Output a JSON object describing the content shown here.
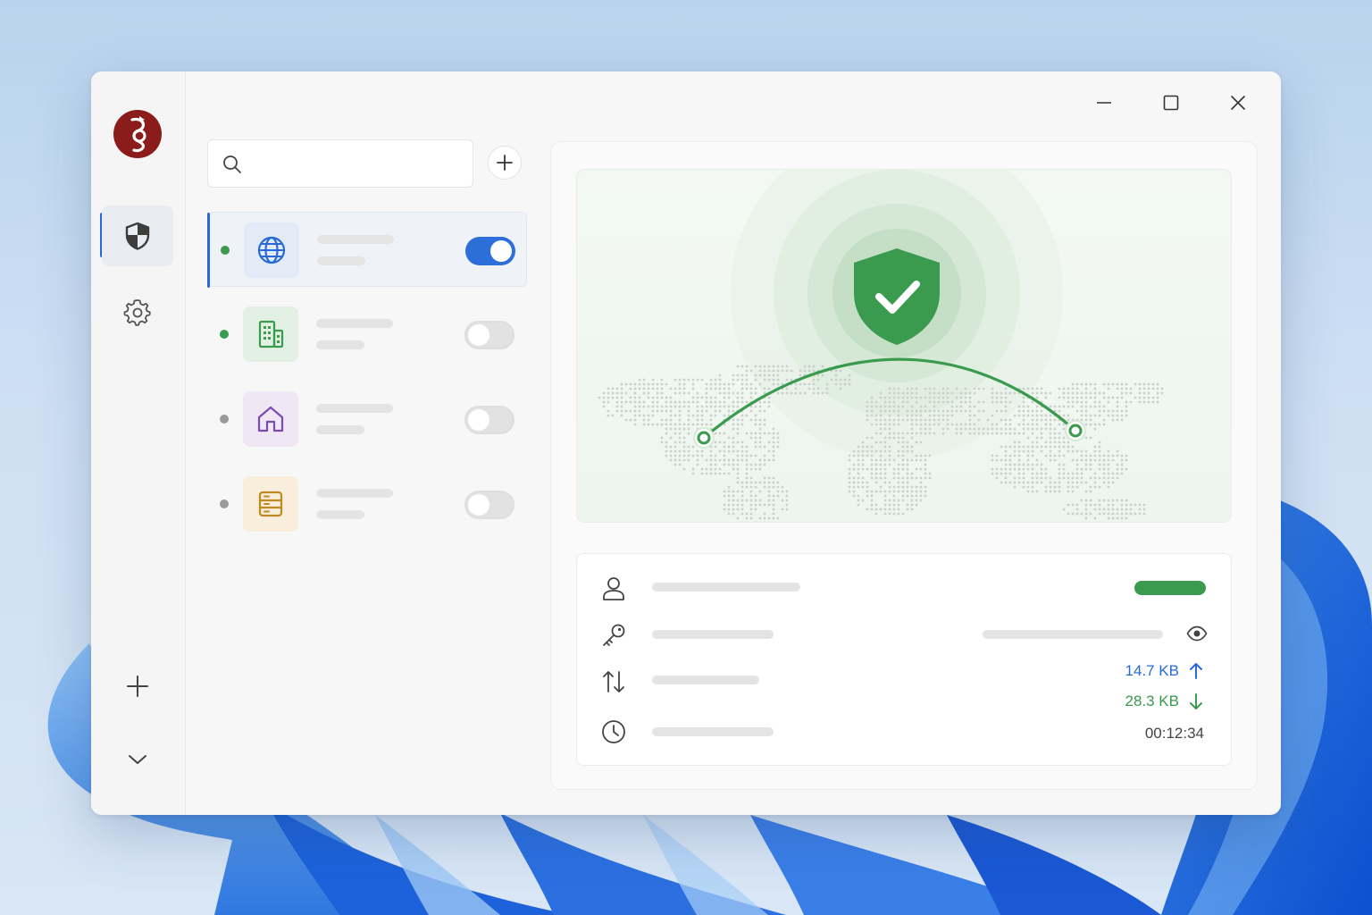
{
  "window": {
    "controls": [
      "minimize",
      "maximize",
      "close"
    ]
  },
  "sidebar": {
    "logo": "wireguard-dragon-logo",
    "items": [
      {
        "icon": "shield-icon",
        "active": true
      },
      {
        "icon": "gear-icon",
        "active": false
      }
    ],
    "footer": [
      {
        "icon": "plus-icon"
      },
      {
        "icon": "chevron-down-icon"
      }
    ]
  },
  "search": {
    "placeholder": "",
    "value": ""
  },
  "tunnels": [
    {
      "icon": "globe-icon",
      "color": "#2a6ad8",
      "tile": "#e3ebf6",
      "status": "active",
      "enabled": true
    },
    {
      "icon": "building-icon",
      "color": "#3a9a4e",
      "tile": "#e3f1e4",
      "status": "active",
      "enabled": false
    },
    {
      "icon": "home-icon",
      "color": "#7b4bb0",
      "tile": "#efe7f4",
      "status": "inactive",
      "enabled": false
    },
    {
      "icon": "server-icon",
      "color": "#c08a1e",
      "tile": "#f8eedb",
      "status": "inactive",
      "enabled": false
    }
  ],
  "connection": {
    "state": "connected",
    "accent": "#3a9a4e",
    "route": [
      "north-america",
      "east-asia"
    ]
  },
  "details": {
    "user_icon": "user-icon",
    "key_icon": "key-icon",
    "reveal_icon": "eye-icon",
    "transfer_icon": "transfer-icon",
    "time_icon": "clock-icon",
    "sent": "14.7 KB",
    "received": "28.3 KB",
    "duration": "00:12:34",
    "sent_color": "#2a6ad8",
    "received_color": "#3a9a4e"
  }
}
